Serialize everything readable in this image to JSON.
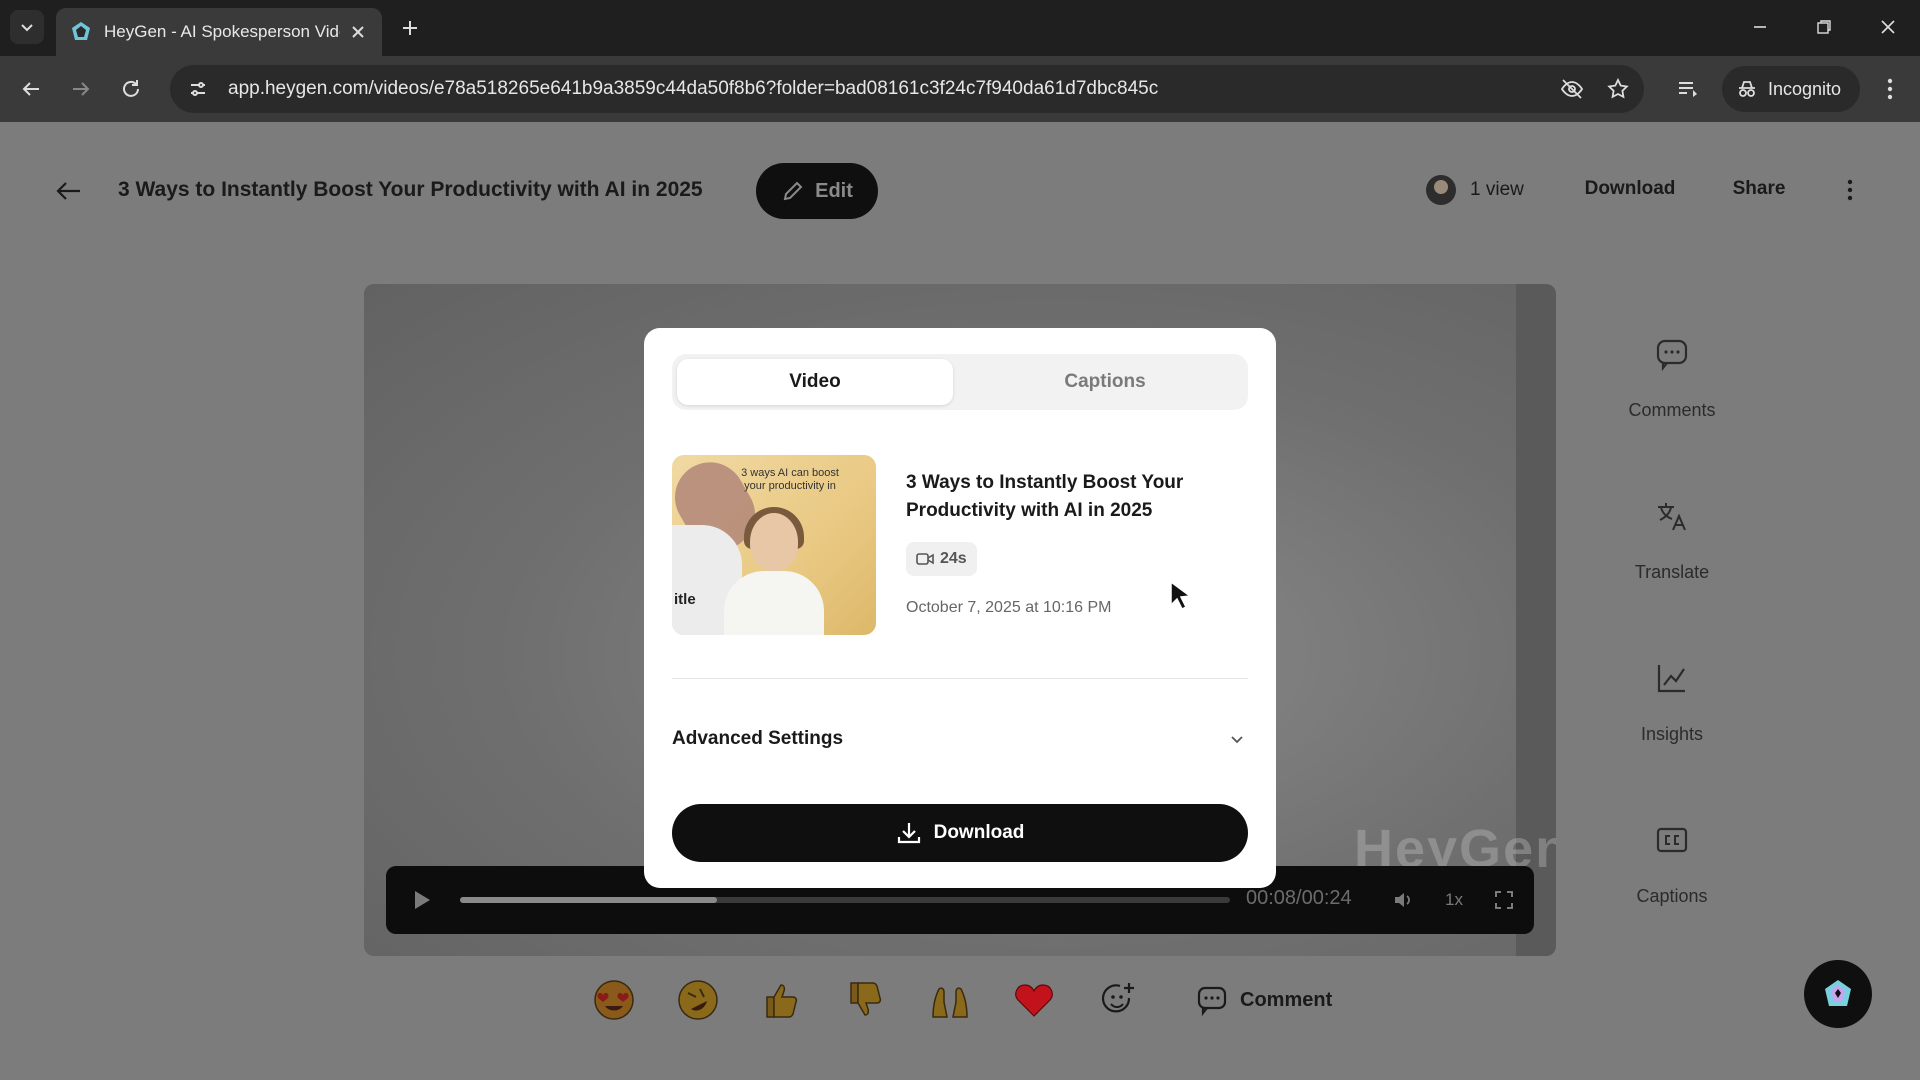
{
  "browser": {
    "tab_title": "HeyGen - AI Spokesperson Vide",
    "url": "app.heygen.com/videos/e78a518265e641b9a3859c44da50f8b6?folder=bad08161c3f24c7f940da61d7dbc845c",
    "incognito_label": "Incognito"
  },
  "header": {
    "title": "3 Ways to Instantly Boost Your Productivity with AI in 2025",
    "edit_label": "Edit",
    "views_label": "1 view",
    "download_label": "Download",
    "share_label": "Share"
  },
  "player": {
    "time": "00:08/00:24",
    "speed": "1x",
    "progress": 0.3333,
    "watermark": "HeyGen"
  },
  "side_panel": {
    "items": [
      {
        "label": "Comments",
        "icon": "comment-icon"
      },
      {
        "label": "Translate",
        "icon": "translate-icon"
      },
      {
        "label": "Insights",
        "icon": "chart-icon"
      },
      {
        "label": "Captions",
        "icon": "cc-icon"
      }
    ]
  },
  "reactions": {
    "comment_label": "Comment",
    "items": [
      "heart-eyes-emoji",
      "rolling-laugh-emoji",
      "thumbs-up-emoji",
      "thumbs-down-emoji",
      "raised-hands-emoji",
      "heart-emoji",
      "add-reaction-icon"
    ]
  },
  "modal": {
    "tabs": {
      "video": "Video",
      "captions": "Captions"
    },
    "video_title": "3 Ways to Instantly Boost Your Productivity with AI in 2025",
    "duration": "24s",
    "date": "October 7, 2025 at 10:16 PM",
    "thumbnail_text": "3 ways AI can boost your productivity in",
    "thumbnail_side_text": "itle",
    "advanced_settings_label": "Advanced Settings",
    "download_label": "Download"
  },
  "colors": {
    "overlay_page": "#7c7c7c",
    "primary_button": "#0f0f0f",
    "heart": "#c2121b"
  }
}
